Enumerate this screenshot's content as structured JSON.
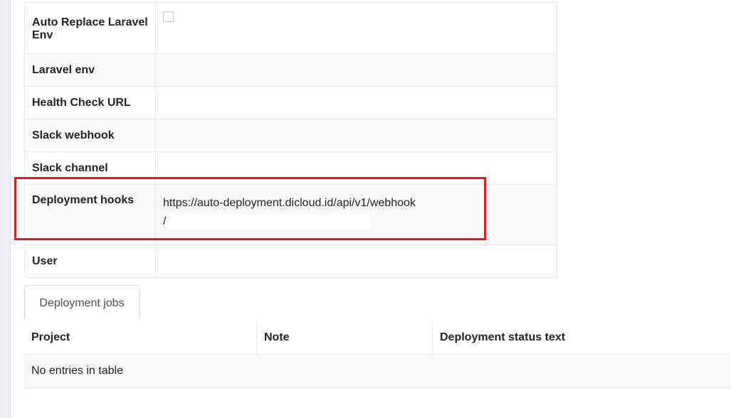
{
  "details": {
    "auto_replace": {
      "label_line1": "Auto Replace Laravel",
      "label_line2": "Env",
      "checked": false
    },
    "laravel_env": {
      "label": "Laravel env",
      "value": ""
    },
    "health_check": {
      "label": "Health Check URL",
      "value": ""
    },
    "slack_webhook": {
      "label": "Slack webhook",
      "value": ""
    },
    "slack_channel": {
      "label": "Slack channel",
      "value": ""
    },
    "deployment_hooks": {
      "label": "Deployment hooks",
      "value_line1": "https://auto-deployment.dicloud.id/api/v1/webhook",
      "value_line2": "/"
    },
    "user": {
      "label": "User",
      "value": ""
    }
  },
  "highlight_color": "#e01b24",
  "tabs": {
    "deployment_jobs": "Deployment jobs"
  },
  "jobs_table": {
    "columns": [
      "Project",
      "Note",
      "Deployment status text"
    ],
    "empty_text": "No entries in table"
  }
}
